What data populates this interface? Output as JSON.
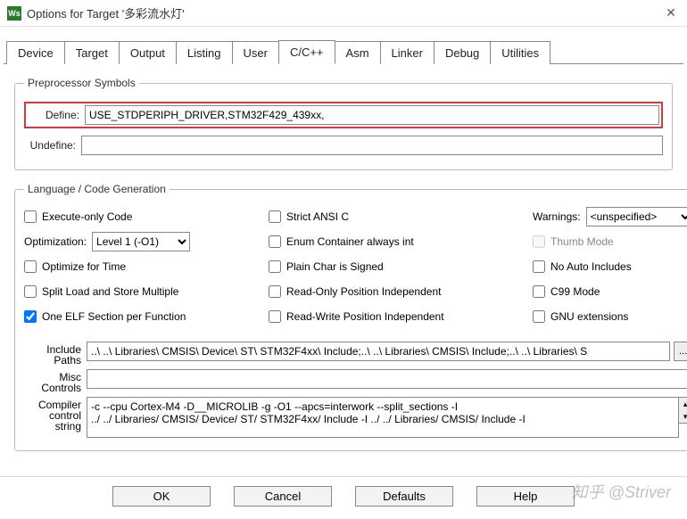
{
  "window": {
    "title": "Options for Target '多彩流水灯'",
    "icon_label": "Ws"
  },
  "tabs": [
    {
      "label": "Device"
    },
    {
      "label": "Target"
    },
    {
      "label": "Output"
    },
    {
      "label": "Listing"
    },
    {
      "label": "User"
    },
    {
      "label": "C/C++",
      "active": true
    },
    {
      "label": "Asm"
    },
    {
      "label": "Linker"
    },
    {
      "label": "Debug"
    },
    {
      "label": "Utilities"
    }
  ],
  "preproc": {
    "legend": "Preprocessor Symbols",
    "define_label": "Define:",
    "define_value": "USE_STDPERIPH_DRIVER,STM32F429_439xx,",
    "undefine_label": "Undefine:",
    "undefine_value": ""
  },
  "langgen": {
    "legend": "Language / Code Generation",
    "execute_only": "Execute-only Code",
    "optimization_label": "Optimization:",
    "optimization_value": "Level 1 (-O1)",
    "optimize_time": "Optimize for Time",
    "split_load": "Split Load and Store Multiple",
    "one_elf": "One ELF Section per Function",
    "strict_ansi": "Strict ANSI C",
    "enum_container": "Enum Container always int",
    "plain_char": "Plain Char is Signed",
    "ro_pi": "Read-Only Position Independent",
    "rw_pi": "Read-Write Position Independent",
    "warnings_label": "Warnings:",
    "warnings_value": "<unspecified>",
    "thumb_mode": "Thumb Mode",
    "no_auto_includes": "No Auto Includes",
    "c99": "C99 Mode",
    "gnu_ext": "GNU extensions"
  },
  "paths": {
    "include_label": "Include\nPaths",
    "include_value": "..\\ ..\\ Libraries\\ CMSIS\\ Device\\ ST\\ STM32F4xx\\ Include;..\\ ..\\ Libraries\\ CMSIS\\ Include;..\\ ..\\ Libraries\\ S",
    "include_btn": "...",
    "misc_label": "Misc\nControls",
    "misc_value": "",
    "compiler_label": "Compiler\ncontrol\nstring",
    "compiler_value": "-c --cpu Cortex-M4 -D__MICROLIB -g -O1 --apcs=interwork --split_sections -I\n../ ../ Libraries/ CMSIS/ Device/ ST/ STM32F4xx/ Include -I ../ ../ Libraries/ CMSIS/ Include -I"
  },
  "buttons": {
    "ok": "OK",
    "cancel": "Cancel",
    "defaults": "Defaults",
    "help": "Help"
  },
  "watermark": "知乎 @Striver"
}
